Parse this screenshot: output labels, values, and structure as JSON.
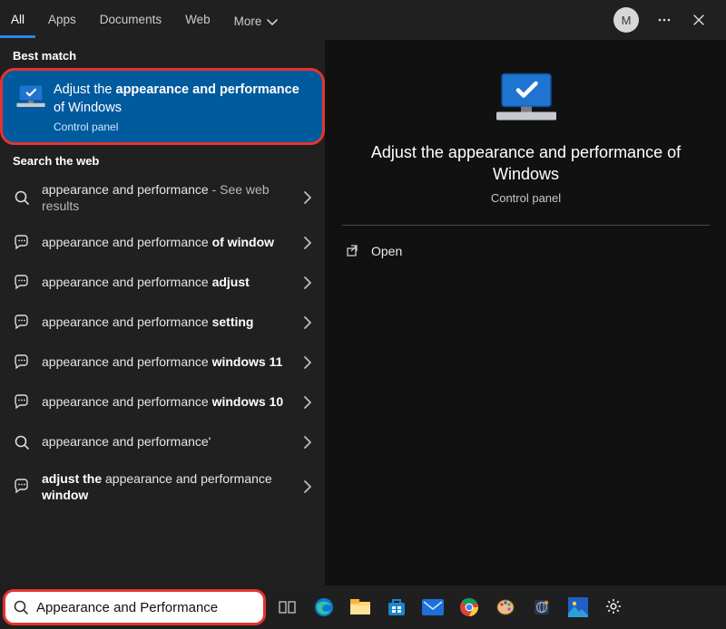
{
  "header": {
    "tabs": [
      "All",
      "Apps",
      "Documents",
      "Web"
    ],
    "more_label": "More",
    "avatar_initial": "M"
  },
  "sections": {
    "best_match": "Best match",
    "web": "Search the web"
  },
  "best_match": {
    "title_html": "Adjust the <b>appearance and performance</b> of Windows",
    "subtitle": "Control panel"
  },
  "web_results": [
    {
      "icon": "search",
      "text_html": "appearance and performance <span class=\"dim\">- See web results</span>"
    },
    {
      "icon": "chat",
      "text_html": "appearance and performance <b>of window</b>"
    },
    {
      "icon": "chat",
      "text_html": "appearance and performance <b>adjust</b>"
    },
    {
      "icon": "chat",
      "text_html": "appearance and performance <b>setting</b>"
    },
    {
      "icon": "chat",
      "text_html": "appearance and performance <b>windows 11</b>"
    },
    {
      "icon": "chat",
      "text_html": "appearance and performance <b>windows 10</b>"
    },
    {
      "icon": "search",
      "text_html": "appearance and performance'"
    },
    {
      "icon": "chat",
      "text_html": "<b>adjust the</b> appearance and performance <b>window</b>"
    }
  ],
  "preview": {
    "title": "Adjust the appearance and performance of Windows",
    "subtitle": "Control panel",
    "actions": {
      "open": "Open"
    }
  },
  "taskbar": {
    "search_value": "Appearance and Performance"
  }
}
